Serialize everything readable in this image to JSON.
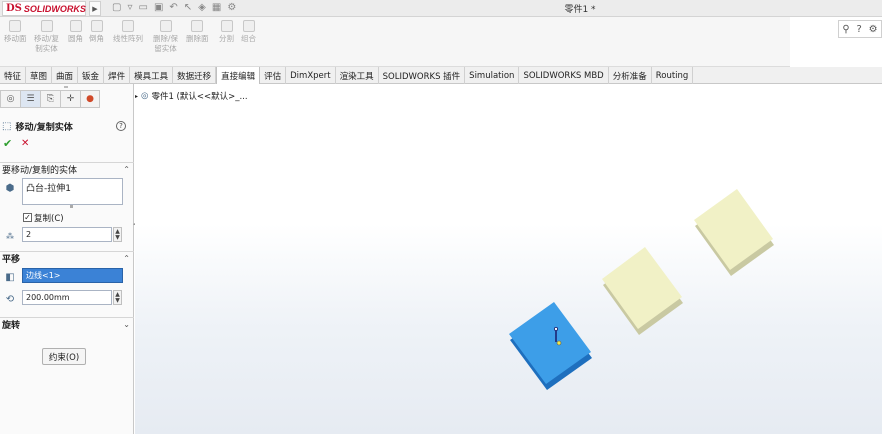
{
  "titlebar": {
    "logo_ds": "DS",
    "logo_text": "SOLIDWORKS",
    "document_title": "零件1 *"
  },
  "commands": [
    {
      "label": "移动面"
    },
    {
      "label": "移动/复\n制实体"
    },
    {
      "label": "圆角"
    },
    {
      "label": "倒角"
    },
    {
      "label": "线性阵列"
    },
    {
      "label": "删除/保\n留实体"
    },
    {
      "label": "删除面"
    },
    {
      "label": "分割"
    },
    {
      "label": "组合"
    }
  ],
  "tabs": [
    "特征",
    "草图",
    "曲面",
    "钣金",
    "焊件",
    "模具工具",
    "数据迁移",
    "直接编辑",
    "评估",
    "DimXpert",
    "渲染工具",
    "SOLIDWORKS 插件",
    "Simulation",
    "SOLIDWORKS MBD",
    "分析准备",
    "Routing"
  ],
  "active_tab": "直接编辑",
  "panel": {
    "title": "移动/复制实体",
    "help": "?",
    "section_bodies": "要移动/复制的实体",
    "selected_body": "凸台-拉伸1",
    "copy_label": "复制(C)",
    "copy_checked": "✓",
    "copy_count": "2",
    "section_translate": "平移",
    "edge_value": "边线<1>",
    "distance_value": "200.00mm",
    "section_rotate": "旋转",
    "constraint_button": "约束(O)"
  },
  "tree": {
    "part_label": "零件1 (默认<<默认>_..."
  },
  "scene": {
    "original_color": "#3d9ee8",
    "copy_color": "#f1f1c6"
  }
}
